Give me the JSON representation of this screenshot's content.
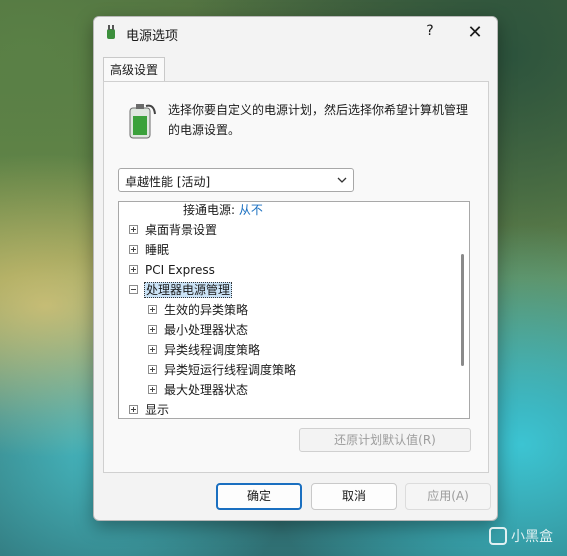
{
  "window": {
    "title": "电源选项",
    "help_label": "?",
    "close_label": "✕"
  },
  "tabs": [
    {
      "label": "高级设置"
    }
  ],
  "description": "选择你要自定义的电源计划，然后选择你希望计算机管理的电源设置。",
  "plan_select": {
    "value": "卓越性能 [活动]"
  },
  "tree": {
    "partial_row": {
      "label": "接通电源:",
      "value": "从不"
    },
    "items": [
      {
        "label": "桌面背景设置",
        "expander": "plus"
      },
      {
        "label": "睡眠",
        "expander": "plus"
      },
      {
        "label": "PCI Express",
        "expander": "plus"
      },
      {
        "label": "处理器电源管理",
        "expander": "minus",
        "selected": true
      },
      {
        "label": "生效的异类策略",
        "expander": "plus",
        "child": true
      },
      {
        "label": "最小处理器状态",
        "expander": "plus",
        "child": true
      },
      {
        "label": "异类线程调度策略",
        "expander": "plus",
        "child": true
      },
      {
        "label": "异类短运行线程调度策略",
        "expander": "plus",
        "child": true
      },
      {
        "label": "最大处理器状态",
        "expander": "plus",
        "child": true
      },
      {
        "label": "显示",
        "expander": "plus"
      }
    ]
  },
  "restore_button": "还原计划默认值(R)",
  "buttons": {
    "ok": "确定",
    "cancel": "取消",
    "apply": "应用(A)"
  },
  "watermark": "小黑盒",
  "colors": {
    "accent": "#1a6fc0",
    "selection": "#cce4f7"
  }
}
